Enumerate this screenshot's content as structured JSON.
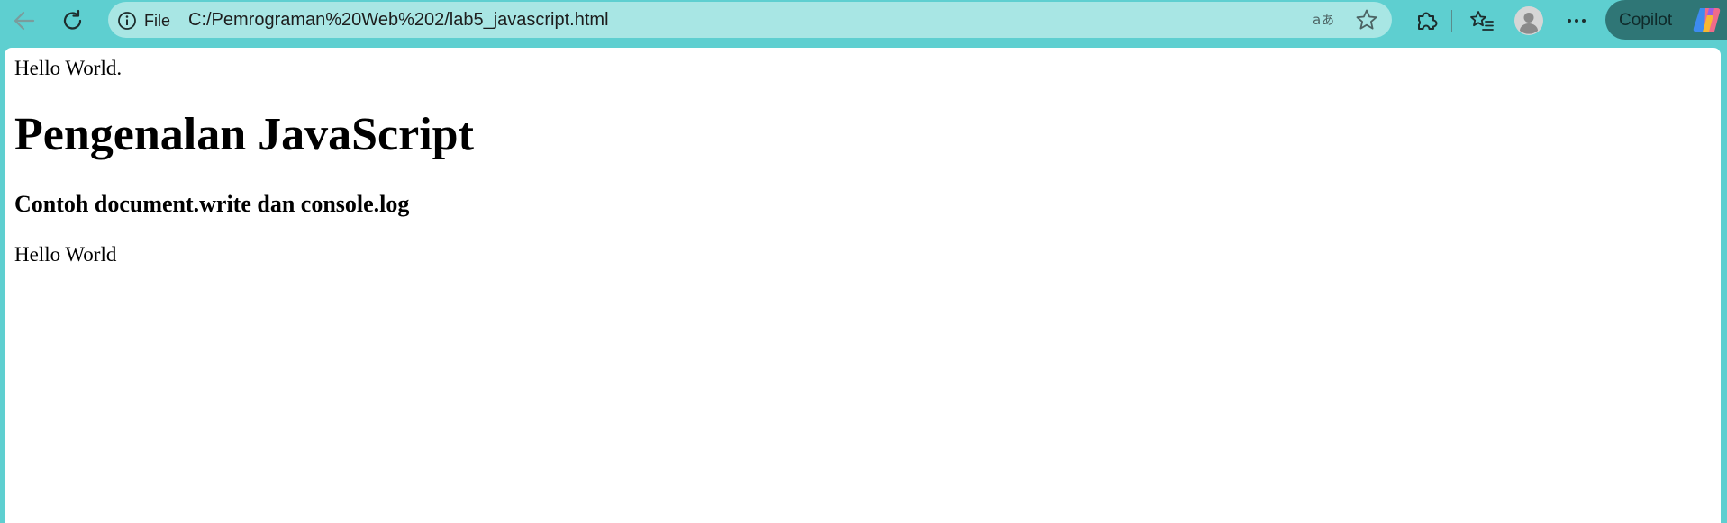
{
  "browser": {
    "address_bar": {
      "scheme_label": "File",
      "url": "C:/Pemrograman%20Web%202/lab5_javascript.html"
    },
    "copilot_label": "Copilot",
    "icons": {
      "back": "arrow-left-icon",
      "reload": "refresh-icon",
      "info": "info-icon",
      "translate": "translate-icon",
      "favorite": "star-icon",
      "extensions": "puzzle-icon",
      "favorites": "favorites-list-icon",
      "profile": "avatar-icon",
      "more": "more-dots-icon",
      "copilot": "copilot-logo-icon"
    },
    "colors": {
      "frame": "#5ecfd0",
      "address_bar": "#a8e6e4",
      "copilot_bg": "#2f7676"
    }
  },
  "page": {
    "text_1": "Hello World.",
    "heading": "Pengenalan JavaScript",
    "subheading": "Contoh document.write dan console.log",
    "text_2": "Hello World"
  }
}
